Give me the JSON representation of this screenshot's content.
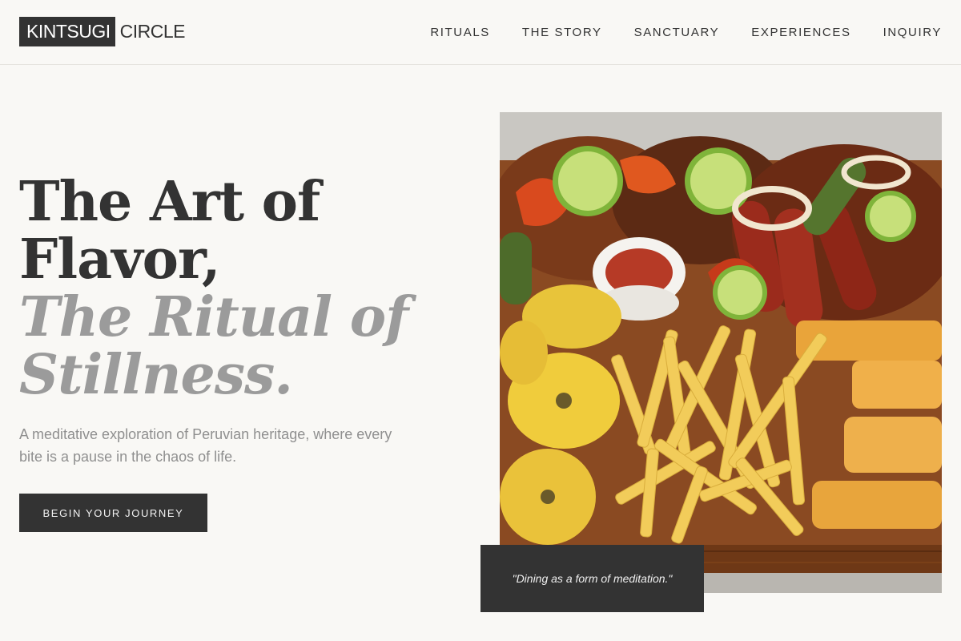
{
  "brand": {
    "boxed": "KINTSUGI",
    "rest": "CIRCLE"
  },
  "nav": [
    {
      "label": "RITUALS"
    },
    {
      "label": "THE STORY"
    },
    {
      "label": "SANCTUARY"
    },
    {
      "label": "EXPERIENCES"
    },
    {
      "label": "INQUIRY"
    }
  ],
  "hero": {
    "line1": "The Art of",
    "line2": "Flavor,",
    "line3": "The Ritual of",
    "line4": "Stillness.",
    "subtitle": "A meditative exploration of Peruvian heritage, where every bite is a pause in the chaos of life.",
    "cta": "BEGIN YOUR JOURNEY"
  },
  "image": {
    "subject": "Peruvian mixed grill platter with fries, tostones, yuca, sausages and limes"
  },
  "quote": "\"Dining as a form of meditation.\"",
  "colors": {
    "background": "#f9f8f5",
    "text": "#333333",
    "muted": "#9b9b9b",
    "dark": "#333333"
  }
}
